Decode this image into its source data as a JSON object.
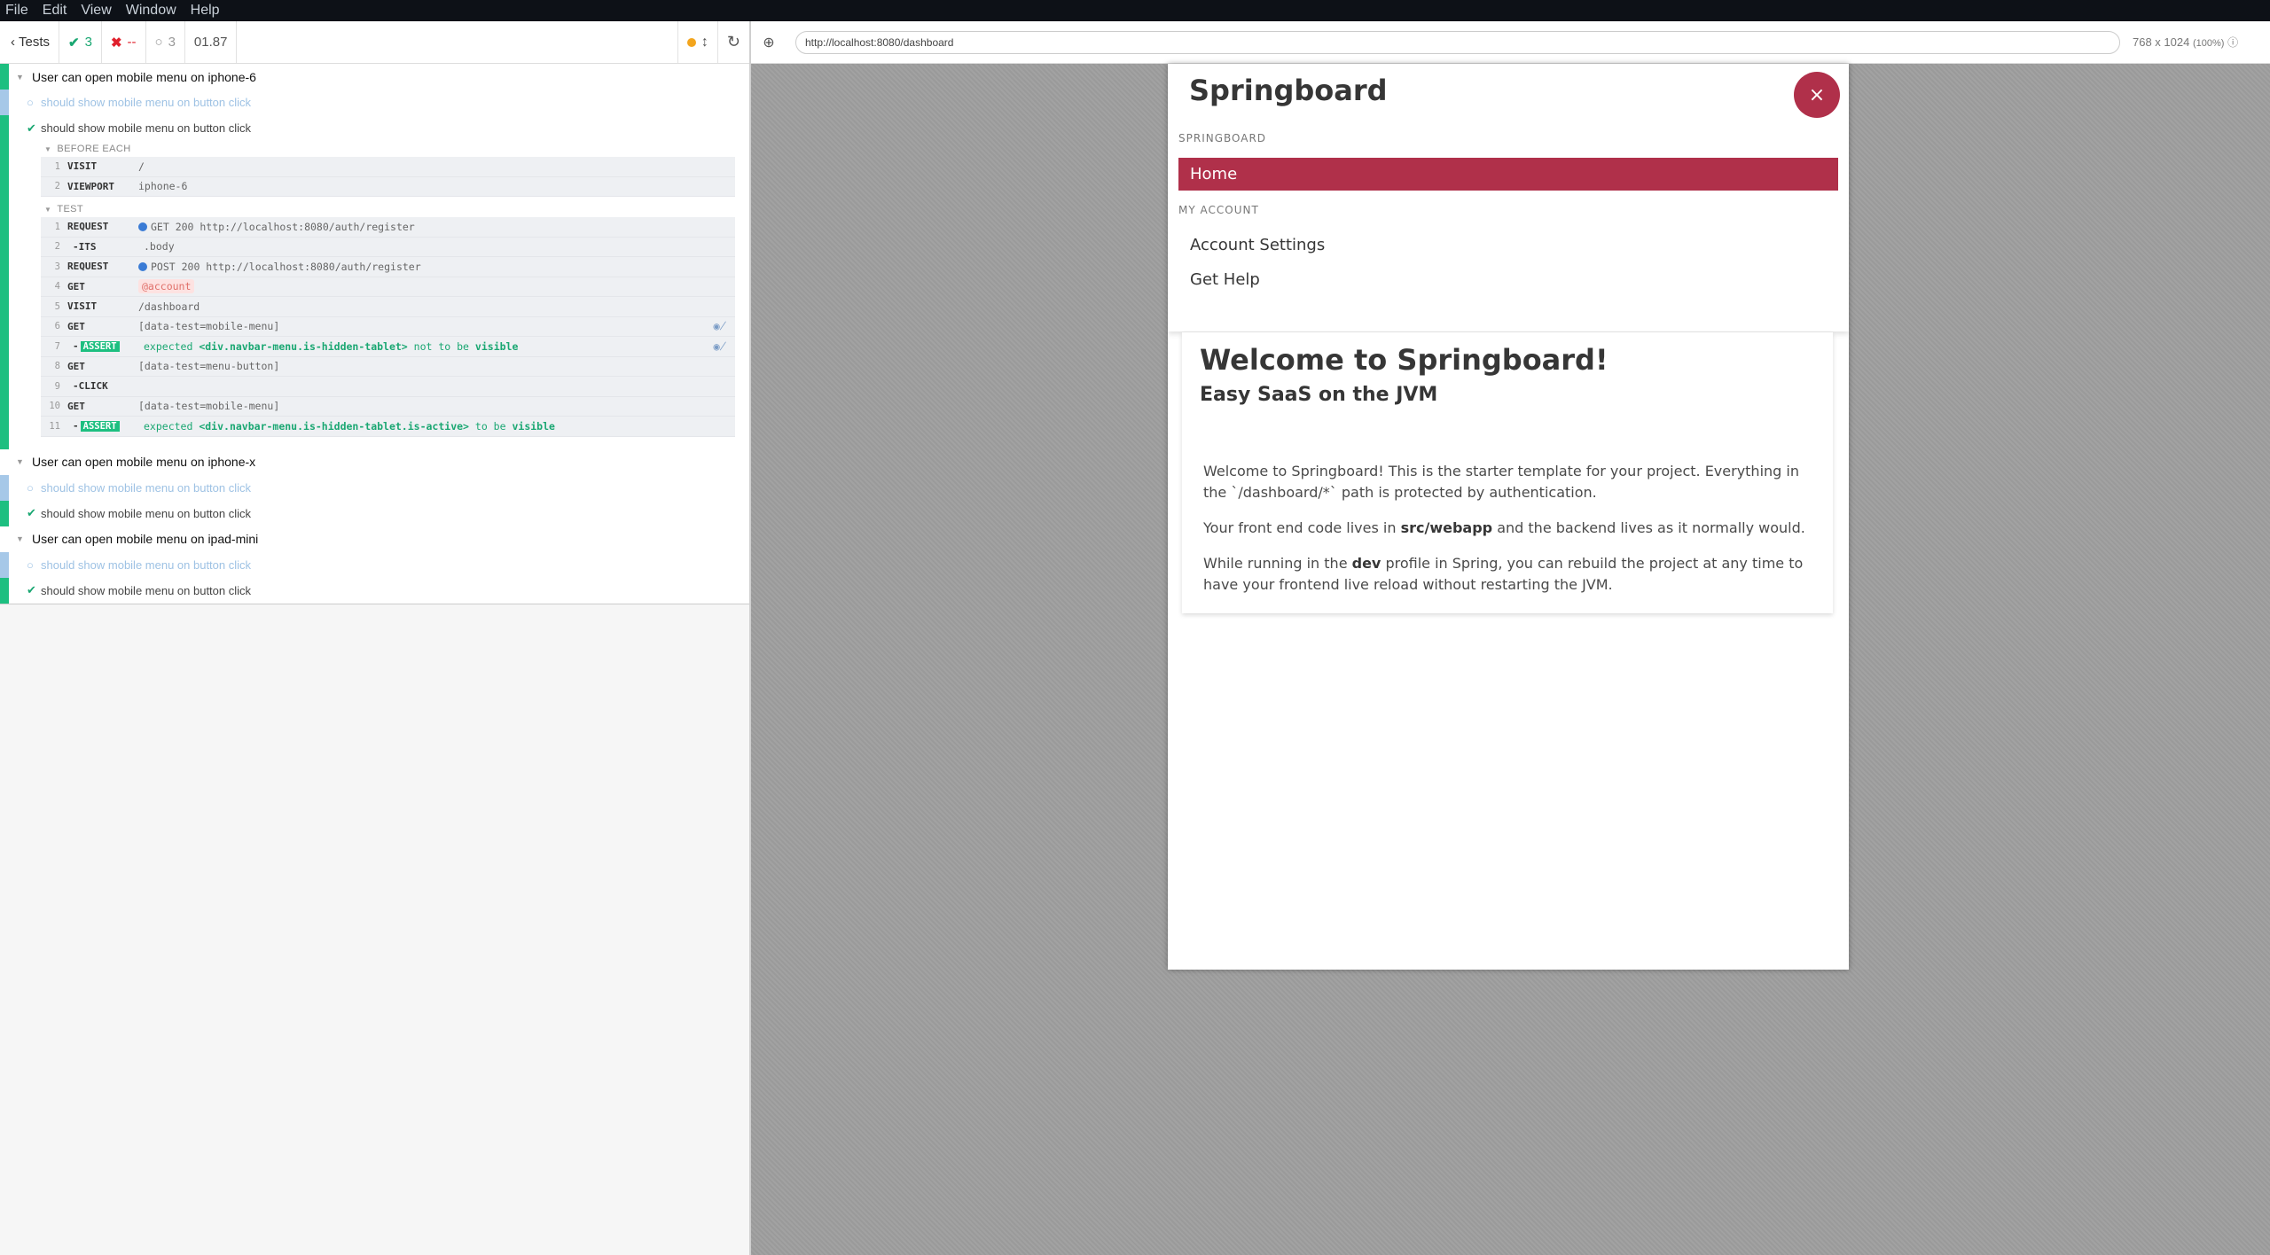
{
  "menubar": {
    "items": [
      "File",
      "Edit",
      "View",
      "Window",
      "Help"
    ]
  },
  "toolbar": {
    "back_label": "Tests",
    "passed": "3",
    "failed": "--",
    "pending": "3",
    "duration": "01.87"
  },
  "runner": {
    "suites": [
      {
        "title": "User can open mobile menu on iphone-6"
      },
      {
        "title": "User can open mobile menu on iphone-x"
      },
      {
        "title": "User can open mobile menu on ipad-mini"
      }
    ],
    "test_title": "should show mobile menu on button click",
    "before_each_label": "BEFORE EACH",
    "test_label": "TEST",
    "before_each": [
      {
        "num": "1",
        "name": "VISIT",
        "msg": "/"
      },
      {
        "num": "2",
        "name": "VIEWPORT",
        "msg": "iphone-6"
      }
    ],
    "commands": [
      {
        "num": "1",
        "name": "REQUEST",
        "msg": "GET 200 http://localhost:8080/auth/register"
      },
      {
        "num": "2",
        "name": "-ITS",
        "msg": ".body"
      },
      {
        "num": "3",
        "name": "REQUEST",
        "msg": "POST 200 http://localhost:8080/auth/register"
      },
      {
        "num": "4",
        "name": "GET",
        "msg": "@account"
      },
      {
        "num": "5",
        "name": "VISIT",
        "msg": "/dashboard"
      },
      {
        "num": "6",
        "name": "GET",
        "msg": "[data-test=mobile-menu]"
      },
      {
        "num": "7",
        "name": "-",
        "badge": "ASSERT",
        "expected": "expected",
        "subject": "<div.navbar-menu.is-hidden-tablet>",
        "rel": "not to be",
        "state": "visible"
      },
      {
        "num": "8",
        "name": "GET",
        "msg": "[data-test=menu-button]"
      },
      {
        "num": "9",
        "name": "-CLICK",
        "msg": ""
      },
      {
        "num": "10",
        "name": "GET",
        "msg": "[data-test=mobile-menu]"
      },
      {
        "num": "11",
        "name": "-",
        "badge": "ASSERT",
        "expected": "expected",
        "subject": "<div.navbar-menu.is-hidden-tablet.is-active>",
        "rel": "to be",
        "state": "visible"
      }
    ]
  },
  "browser": {
    "url": "http://localhost:8080/dashboard",
    "viewport": "768 x 1024",
    "scale": "(100%)"
  },
  "app": {
    "brand": "Springboard",
    "close_glyph": "×",
    "section_springboard": "SPRINGBOARD",
    "home": "Home",
    "section_account": "MY ACCOUNT",
    "account_settings": "Account Settings",
    "get_help": "Get Help",
    "card": {
      "title": "Welcome to Springboard!",
      "subtitle": "Easy SaaS on the JVM",
      "p1": "Welcome to Springboard! This is the starter template for your project. Everything in the `/dashboard/*` path is protected by authentication.",
      "p2_a": "Your front end code lives in ",
      "p2_b": "src/webapp",
      "p2_c": " and the backend lives as it normally would.",
      "p3_a": "While running in the ",
      "p3_b": "dev",
      "p3_c": " profile in Spring, you can rebuild the project at any time to have your frontend live reload without restarting the JVM."
    }
  }
}
